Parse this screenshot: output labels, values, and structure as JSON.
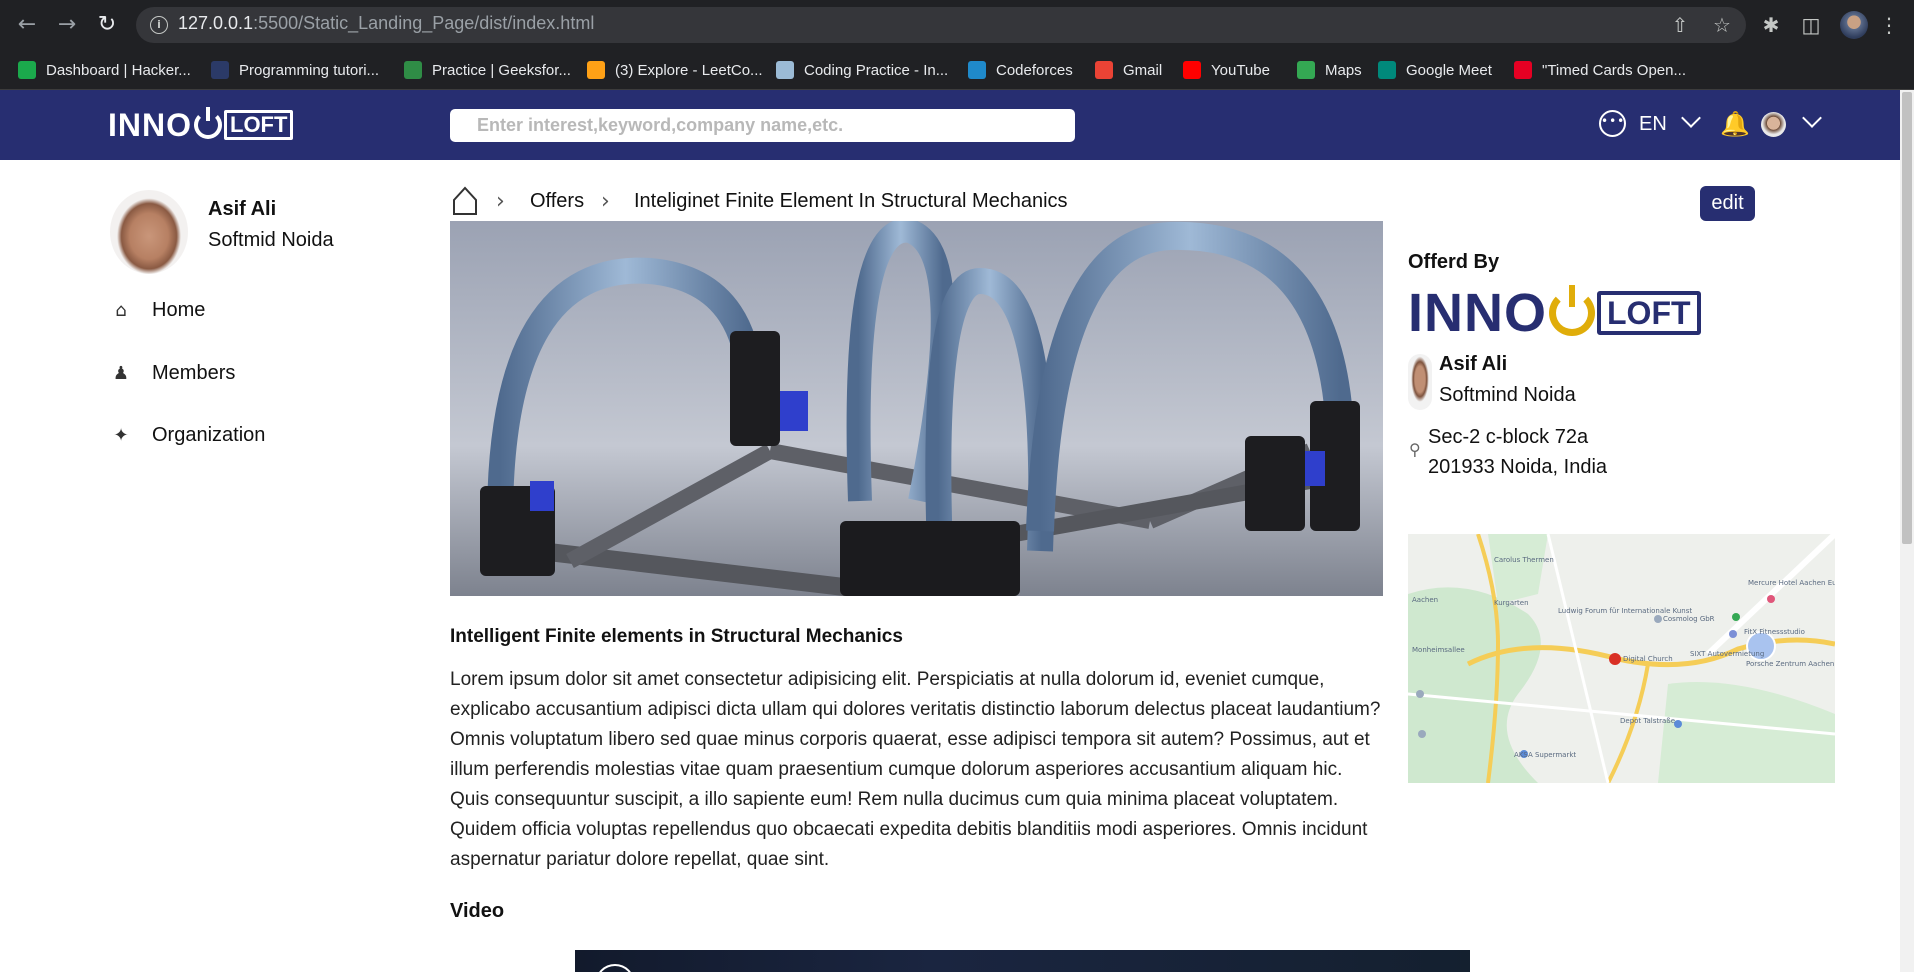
{
  "browser": {
    "url_host": "127.0.0.1",
    "url_rest": ":5500/Static_Landing_Page/dist/index.html",
    "bookmarks": [
      {
        "label": "Dashboard | Hacker...",
        "icon": "hackerrank-icon",
        "color": "#1ba94c"
      },
      {
        "label": "Programming tutori...",
        "icon": "tutorial-icon",
        "color": "#2b3a67"
      },
      {
        "label": "Practice | Geeksfor...",
        "icon": "geeksforgeeks-icon",
        "color": "#2f8d46"
      },
      {
        "label": "(3) Explore - LeetCo...",
        "icon": "leetcode-icon",
        "color": "#ffa116"
      },
      {
        "label": "Coding Practice - In...",
        "icon": "interviewbit-icon",
        "color": "#9bbbd6"
      },
      {
        "label": "Codeforces",
        "icon": "codeforces-icon",
        "color": "#1f8acb"
      },
      {
        "label": "Gmail",
        "icon": "gmail-icon",
        "color": "#ea4335"
      },
      {
        "label": "YouTube",
        "icon": "youtube-icon",
        "color": "#ff0000"
      },
      {
        "label": "Maps",
        "icon": "maps-icon",
        "color": "#34a853"
      },
      {
        "label": "Google Meet",
        "icon": "google-meet-icon",
        "color": "#00897b"
      },
      {
        "label": "\"Timed Cards Open...",
        "icon": "pinterest-icon",
        "color": "#e60023"
      }
    ]
  },
  "header": {
    "logo_left": "INNO",
    "logo_right": "LOFT",
    "search_placeholder": "Enter interest,keyword,company name,etc.",
    "language": "EN",
    "brand_color": "#272e71"
  },
  "sidebar": {
    "user_name": "Asif Ali",
    "user_company": "Softmid Noida",
    "items": [
      {
        "label": "Home",
        "icon": "home-icon"
      },
      {
        "label": "Members",
        "icon": "members-icon"
      },
      {
        "label": "Organization",
        "icon": "organization-icon"
      }
    ]
  },
  "breadcrumb": {
    "items": [
      "Offers",
      "Inteliginet Finite Element In Structural Mechanics"
    ]
  },
  "edit_label": "edit",
  "offer": {
    "title": "Intelligent Finite elements in Structural Mechanics",
    "description": "Lorem ipsum dolor sit amet consectetur adipisicing elit. Perspiciatis at nulla dolorum id, eveniet cumque, explicabo accusantium adipisci dicta ullam qui dolores veritatis distinctio laborum delectus placeat laudantium? Omnis voluptatum libero sed quae minus corporis quaerat, esse adipisci tempora sit autem? Possimus, aut et illum perferendis molestias vitae quam praesentium cumque dolorum asperiores accusantium aliquam hic. Quis consequuntur suscipit, a illo sapiente eum! Rem nulla ducimus cum quia minima placeat voluptatem. Quidem officia voluptas repellendus quo obcaecati expedita debitis blanditiis modi asperiores. Omnis incidunt aspernatur pariatur dolore repellat, quae sint.",
    "video_heading": "Video"
  },
  "offered_by": {
    "heading": "Offerd By",
    "logo_left": "INNO",
    "logo_right": "LOFT",
    "owner_name": "Asif Ali",
    "owner_company": "Softmind Noida",
    "address_line1": "Sec-2 c-block 72a",
    "address_line2": "201933 Noida, India",
    "accent_color": "#e0ad0a"
  },
  "map": {
    "labels": [
      "Carolus Thermen",
      "Kurgarten",
      "Ludwig Forum für Internationale Kunst",
      "Cosmolog GbR",
      "Mercure Hotel Aachen Europaplatz",
      "FitX Fitnessstudio",
      "SIXT Autovermietung",
      "Porsche Zentrum Aachen",
      "Digital Church",
      "Monheimsallee",
      "Depot Talstraße",
      "AKSA Supermarkt",
      "Aachen"
    ]
  }
}
